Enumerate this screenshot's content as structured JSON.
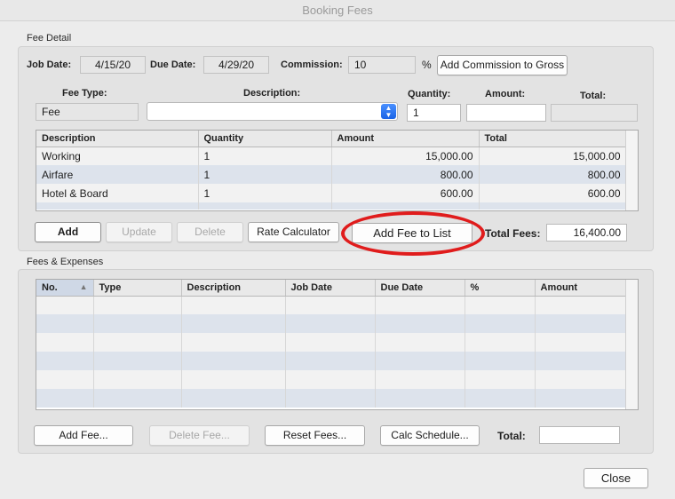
{
  "window": {
    "title": "Booking Fees"
  },
  "fee_detail": {
    "group_label": "Fee Detail",
    "job_date_label": "Job Date:",
    "job_date": "4/15/20",
    "due_date_label": "Due Date:",
    "due_date": "4/29/20",
    "commission_label": "Commission:",
    "commission": "10",
    "percent_sign": "%",
    "add_commission_button": "Add Commission to Gross",
    "fee_type_label": "Fee Type:",
    "fee_type": "Fee",
    "description_label": "Description:",
    "description_value": "",
    "quantity_label": "Quantity:",
    "quantity": "1",
    "amount_label": "Amount:",
    "amount": "",
    "total_label": "Total:",
    "total": "",
    "table": {
      "columns": [
        "Description",
        "Quantity",
        "Amount",
        "Total"
      ],
      "rows": [
        [
          "Working",
          "1",
          "15,000.00",
          "15,000.00"
        ],
        [
          "Airfare",
          "1",
          "800.00",
          "800.00"
        ],
        [
          "Hotel & Board",
          "1",
          "600.00",
          "600.00"
        ]
      ]
    },
    "buttons": {
      "add": "Add",
      "update": "Update",
      "delete": "Delete",
      "rate_calculator": "Rate Calculator",
      "add_fee_to_list": "Add Fee to List"
    },
    "total_fees_label": "Total Fees:",
    "total_fees": "16,400.00"
  },
  "fees_expenses": {
    "group_label": "Fees & Expenses",
    "table": {
      "columns": [
        "No.",
        "Type",
        "Description",
        "Job Date",
        "Due Date",
        "%",
        "Amount"
      ],
      "sort_indicator": "▲"
    },
    "buttons": {
      "add_fee": "Add Fee...",
      "delete_fee": "Delete Fee...",
      "reset_fees": "Reset Fees...",
      "calc_schedule": "Calc Schedule..."
    },
    "total_label": "Total:",
    "total": ""
  },
  "close_button": "Close",
  "colors": {
    "highlight_ring": "#e01c1c",
    "row_alt": "#dde3ec",
    "accent": "#1a63e6"
  }
}
